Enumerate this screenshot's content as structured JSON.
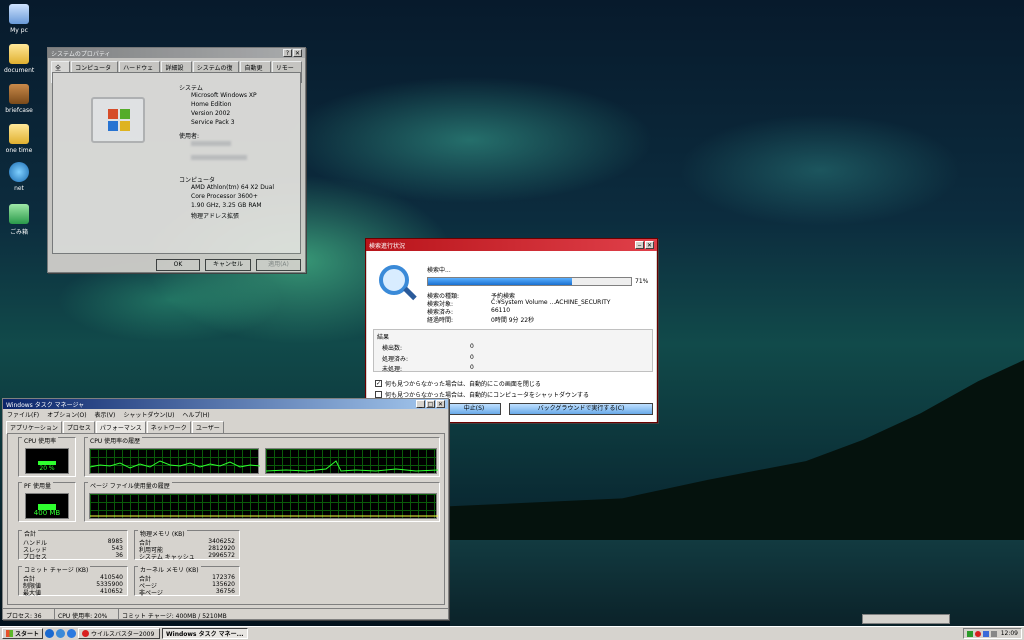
{
  "desktop_icons": [
    "My pc",
    "document",
    "briefcase",
    "one time",
    "net",
    "ごみ箱"
  ],
  "sysprop": {
    "title": "システムのプロパティ",
    "title_buttons": [
      "?",
      "✕"
    ],
    "tabs": [
      "全般",
      "コンピュータ名",
      "ハードウェア",
      "詳細設定",
      "システムの復元",
      "自動更新",
      "リモート"
    ],
    "system_heading": "システム",
    "os_lines": [
      "Microsoft Windows XP",
      "Home Edition",
      "Version 2002",
      "Service Pack 3"
    ],
    "user_heading": "使用者:",
    "computer_heading": "コンピュータ",
    "cpu_lines": [
      "AMD Athlon(tm) 64 X2 Dual",
      "Core Processor 3600+",
      "1.90 GHz, 3.25 GB RAM",
      "物理アドレス拡張"
    ],
    "ok": "OK",
    "cancel": "キャンセル",
    "apply": "適用(A)"
  },
  "scan": {
    "title": "検索進行状況",
    "title_buttons": [
      "‒",
      "✕"
    ],
    "status": "検索中...",
    "progress_pct": 71,
    "progress_label": "71%",
    "details": [
      {
        "k": "検索の種類:",
        "v": "予約検索"
      },
      {
        "k": "検索対象:",
        "v": "C:¥System Volume ...ACHINE_SECURITY"
      },
      {
        "k": "検索済み:",
        "v": "66110"
      },
      {
        "k": "経過時間:",
        "v": "0時間 9分 22秒"
      }
    ],
    "results_heading": "結果",
    "results": [
      {
        "k": "検出数:",
        "v": "0"
      },
      {
        "k": "処理済み:",
        "v": "0"
      },
      {
        "k": "未処理:",
        "v": "0"
      }
    ],
    "check1": "何も見つからなかった場合は、自動的にこの画面を閉じる",
    "check2": "何も見つからなかった場合は、自動的にコンピュータをシャットダウンする",
    "stop": "中止(S)",
    "background": "バックグラウンドで実行する(C)"
  },
  "taskmgr": {
    "title": "Windows タスク マネージャ",
    "title_buttons": [
      "_",
      "□",
      "✕"
    ],
    "menu": [
      "ファイル(F)",
      "オプション(O)",
      "表示(V)",
      "シャットダウン(U)",
      "ヘルプ(H)"
    ],
    "tabs": [
      "アプリケーション",
      "プロセス",
      "パフォーマンス",
      "ネットワーク",
      "ユーザー"
    ],
    "cpu_usage": "CPU 使用率",
    "cpu_value": "20 %",
    "cpu_history": "CPU 使用率の履歴",
    "pf_usage": "PF 使用量",
    "pf_value": "400 MB",
    "pf_history": "ページ ファイル使用量の履歴",
    "totals_heading": "合計",
    "totals": [
      {
        "k": "ハンドル",
        "v": "8985"
      },
      {
        "k": "スレッド",
        "v": "543"
      },
      {
        "k": "プロセス",
        "v": "36"
      }
    ],
    "phys_heading": "物理メモリ (KB)",
    "phys": [
      {
        "k": "合計",
        "v": "3406252"
      },
      {
        "k": "利用可能",
        "v": "2812920"
      },
      {
        "k": "システム キャッシュ",
        "v": "2996572"
      }
    ],
    "commit_heading": "コミット チャージ (KB)",
    "commit": [
      {
        "k": "合計",
        "v": "410540"
      },
      {
        "k": "制限値",
        "v": "5335900"
      },
      {
        "k": "最大値",
        "v": "410652"
      }
    ],
    "kernel_heading": "カーネル メモリ (KB)",
    "kernel": [
      {
        "k": "合計",
        "v": "172376"
      },
      {
        "k": "ページ",
        "v": "135620"
      },
      {
        "k": "非ページ",
        "v": "36756"
      }
    ],
    "status_processes": "プロセス: 36",
    "status_cpu": "CPU 使用率: 20%",
    "status_commit": "コミット チャージ: 400MB / 5210MB"
  },
  "taskbar": {
    "start": "スタート",
    "items": [
      "ウイルスバスター2009",
      "Windows タスク マネー..."
    ],
    "clock": "12:09"
  }
}
